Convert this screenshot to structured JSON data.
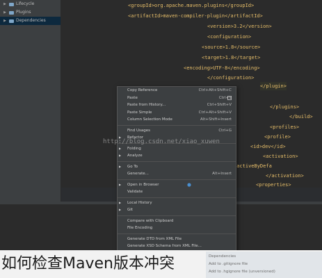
{
  "project_tree": {
    "items": [
      {
        "label": "Lifecycle",
        "icon": "folder-icon"
      },
      {
        "label": "Plugins",
        "icon": "folder-icon"
      },
      {
        "label": "Dependencies",
        "icon": "folder-icon"
      }
    ]
  },
  "editor": {
    "lines": [
      "<groupId>org.apache.maven.plugins</groupId>",
      "<artifactId>maven-compiler-plugin</artifactId>",
      "<version>3.2</version>",
      "<configuration>",
      "<source>1.8</source>",
      "<target>1.8</target>",
      "<encoding>UTF-8</encoding>",
      "</configuration>",
      "</plugin>",
      "</plugins>",
      "</build>",
      "<profiles>",
      "<profile>",
      "<id>dev</id>",
      "<activation>",
      "<activeByDefa",
      "</activation>",
      "<properties>"
    ]
  },
  "context_menu": {
    "items": [
      {
        "label": "Copy Reference",
        "shortcut": "Ctrl+Alt+Shift+C",
        "submenu": false
      },
      {
        "label": "Paste",
        "shortcut": "Ctrl+V",
        "submenu": false
      },
      {
        "label": "Paste from History...",
        "shortcut": "Ctrl+Shift+V",
        "submenu": false
      },
      {
        "label": "Paste Simple",
        "shortcut": "Ctrl+Alt+Shift+V",
        "submenu": false
      },
      {
        "label": "Column Selection Mode",
        "shortcut": "Alt+Shift+Insert",
        "submenu": false
      },
      {
        "sep": true
      },
      {
        "label": "Find Usages",
        "shortcut": "Ctrl+G",
        "submenu": false
      },
      {
        "label": "Refactor",
        "shortcut": "",
        "submenu": true
      },
      {
        "sep": true
      },
      {
        "label": "Folding",
        "shortcut": "",
        "submenu": true
      },
      {
        "label": "Analyze",
        "shortcut": "",
        "submenu": true
      },
      {
        "sep": true
      },
      {
        "label": "Go To",
        "shortcut": "",
        "submenu": true
      },
      {
        "label": "Generate...",
        "shortcut": "Alt+Insert",
        "submenu": false
      },
      {
        "sep": true
      },
      {
        "label": "Open in Browser",
        "shortcut": "",
        "submenu": true
      },
      {
        "label": "Validate",
        "shortcut": "",
        "submenu": false
      },
      {
        "sep": true
      },
      {
        "label": "Local History",
        "shortcut": "",
        "submenu": true
      },
      {
        "label": "Git",
        "shortcut": "",
        "submenu": true
      },
      {
        "sep": true
      },
      {
        "label": "Compare with Clipboard",
        "shortcut": "",
        "submenu": false
      },
      {
        "label": "File Encoding",
        "shortcut": "",
        "submenu": false
      },
      {
        "sep": true
      },
      {
        "label": "Generate DTD from XML File",
        "shortcut": "",
        "submenu": false
      },
      {
        "label": "Generate XSD Schema from XML File...",
        "shortcut": "",
        "submenu": false
      }
    ]
  },
  "watermark": "http://blog.csdn.net/xiao_xuwen",
  "peek_items": [
    "Dependencies",
    "Add to .gitignore file",
    "Add to .hgignore file (unversioned)"
  ],
  "caption": "如何检查Maven版本冲突",
  "colors": {
    "background": "#2b2b2b",
    "menu_bg": "#3c3f41",
    "xml_tag": "#e8bf6a",
    "selection": "#4b6eaf"
  }
}
